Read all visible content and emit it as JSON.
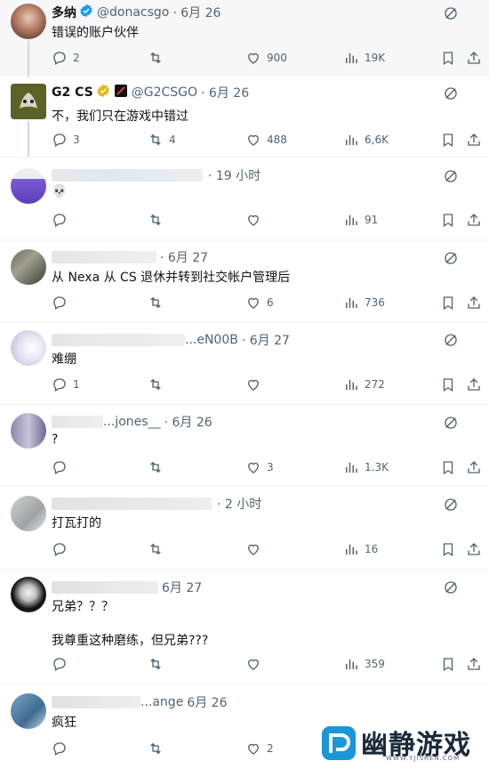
{
  "tweets": [
    {
      "name": "多纳",
      "verified": "blue",
      "handle": "@donacsgo",
      "time": "· 6月 26",
      "text": "错误的账户伙伴",
      "reply": "2",
      "retweet": "",
      "like": "900",
      "views": "19K"
    },
    {
      "name": "G2 CS",
      "verified": "gold",
      "handle": "@G2CSGO",
      "time": "· 6月 26",
      "text": "不，我们只在游戏中错过",
      "reply": "3",
      "retweet": "4",
      "like": "488",
      "views": "6,6K"
    },
    {
      "name": "",
      "handle": "",
      "time": "· 19 小时",
      "text": "💀",
      "reply": "",
      "retweet": "",
      "like": "",
      "views": "91"
    },
    {
      "name": "",
      "handle": "",
      "time": "· 6月 27",
      "text": "从 Nexa 从 CS 退休并转到社交帐户管理后",
      "reply": "",
      "retweet": "",
      "like": "6",
      "views": "736"
    },
    {
      "name": "",
      "handle": "...eN00B",
      "time": "· 6月 27",
      "text": "难绷",
      "reply": "1",
      "retweet": "",
      "like": "",
      "views": "272"
    },
    {
      "name": "",
      "handle": "...jones__",
      "time": "· 6月 26",
      "text": "?",
      "reply": "",
      "retweet": "",
      "like": "3",
      "views": "1.3K"
    },
    {
      "name": "",
      "handle": "",
      "time": "· 2 小时",
      "text": "打瓦打的",
      "reply": "",
      "retweet": "",
      "like": "",
      "views": "16"
    },
    {
      "name": "",
      "handle": "",
      "time": "6月 27",
      "text": "兄弟？？？",
      "text2": "我尊重这种磨练，但兄弟???",
      "reply": "",
      "retweet": "",
      "like": "",
      "views": "359"
    },
    {
      "name": "",
      "handle": "...ange",
      "time": "6月 26",
      "text": "疯狂",
      "reply": "",
      "retweet": "",
      "like": "2",
      "views": ""
    }
  ],
  "watermark": {
    "title": "幽静游戏",
    "url": "WWW.YJISREN.COM"
  },
  "colors": {
    "verified_blue": "#1d9bf0",
    "verified_gold": "#e2b719",
    "icon_gray": "#536471"
  }
}
